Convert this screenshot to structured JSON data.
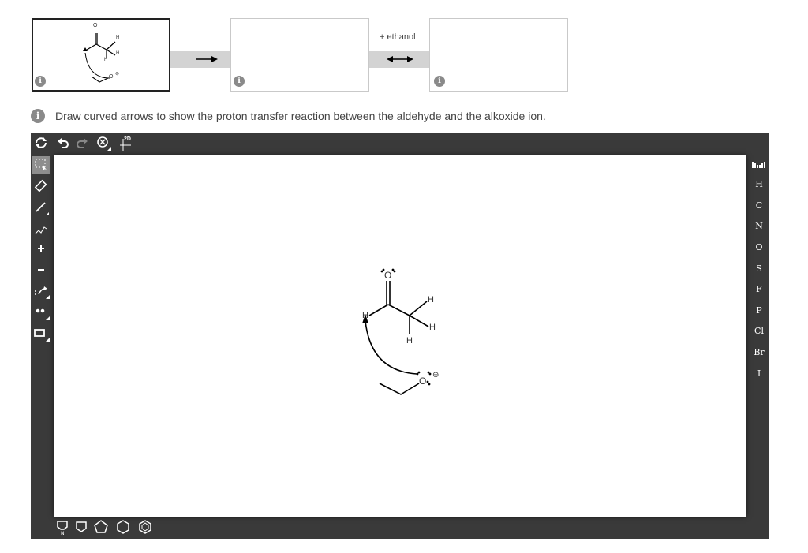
{
  "steps": {
    "connector_label": "+ ethanol",
    "info_glyph": "i"
  },
  "instruction": {
    "text": "Draw curved arrows to show the proton transfer reaction between the aldehyde and the alkoxide ion."
  },
  "molecule": {
    "atom_O": "O",
    "atom_H_aldehyde": "H",
    "atom_H_top": "H",
    "atom_H_right": "H",
    "atom_H_bottom": "H",
    "atom_O_alkoxide": "O",
    "charge": "⊖"
  },
  "toolbar": {
    "view_2d_label": "2D"
  },
  "elements": [
    "H",
    "C",
    "N",
    "O",
    "S",
    "F",
    "P",
    "Cl",
    "Br",
    "I"
  ],
  "icons": {
    "top": [
      "refresh-icon",
      "undo-icon",
      "redo-icon",
      "zoom-reset-icon",
      "2d-view-icon"
    ],
    "left": [
      "select-icon",
      "eraser-icon",
      "bond-icon",
      "chain-icon",
      "plus-charge-icon",
      "minus-charge-icon",
      "curved-arrow-icon",
      "lone-pair-icon",
      "rectangle-icon"
    ],
    "bottom": [
      "pyranose-icon",
      "square-ring-icon",
      "pentagon-ring-icon",
      "hexagon-ring-icon",
      "benzene-icon"
    ]
  }
}
